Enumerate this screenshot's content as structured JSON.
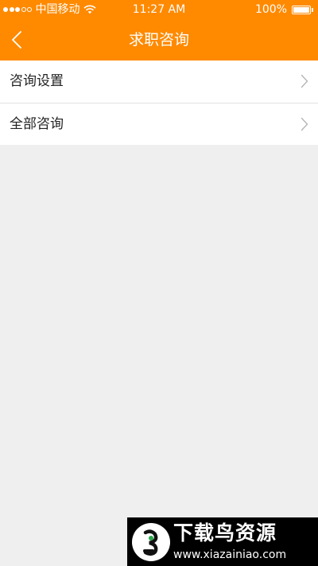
{
  "status_bar": {
    "carrier": "中国移动",
    "time": "11:27 AM",
    "battery": "100%",
    "signal_bars_filled": 3,
    "signal_bars_total": 5
  },
  "header": {
    "title": "求职咨询",
    "back_icon": "chevron-left-icon"
  },
  "menu": {
    "items": [
      {
        "label": "咨询设置",
        "icon": "chevron-right-icon"
      },
      {
        "label": "全部咨询",
        "icon": "chevron-right-icon"
      }
    ]
  },
  "watermark": {
    "title": "下载鸟资源",
    "url": "www.xiazainiao.com"
  },
  "colors": {
    "accent": "#ff8a00",
    "background": "#efefef",
    "list_bg": "#ffffff",
    "text": "#222222",
    "chevron": "#b5b5b5"
  }
}
